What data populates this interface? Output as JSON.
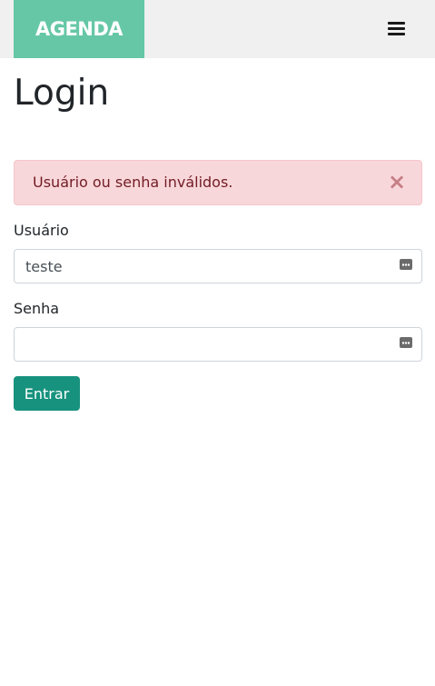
{
  "navbar": {
    "brand": "AGENDA",
    "menu_icon": "hamburger-menu-icon"
  },
  "page": {
    "title": "Login"
  },
  "alert": {
    "message": "Usuário ou senha inválidos.",
    "close_label": "×",
    "close_icon": "close-icon"
  },
  "form": {
    "username": {
      "label": "Usuário",
      "value": "teste",
      "icon": "password-manager-key-icon"
    },
    "password": {
      "label": "Senha",
      "value": "",
      "icon": "password-manager-key-icon"
    },
    "submit_label": "Entrar"
  },
  "colors": {
    "brand_bg": "#66c7a6",
    "navbar_bg": "#f0f0f0",
    "alert_bg": "#f8d7da",
    "alert_text": "#721c24",
    "button_bg": "#17927e"
  }
}
